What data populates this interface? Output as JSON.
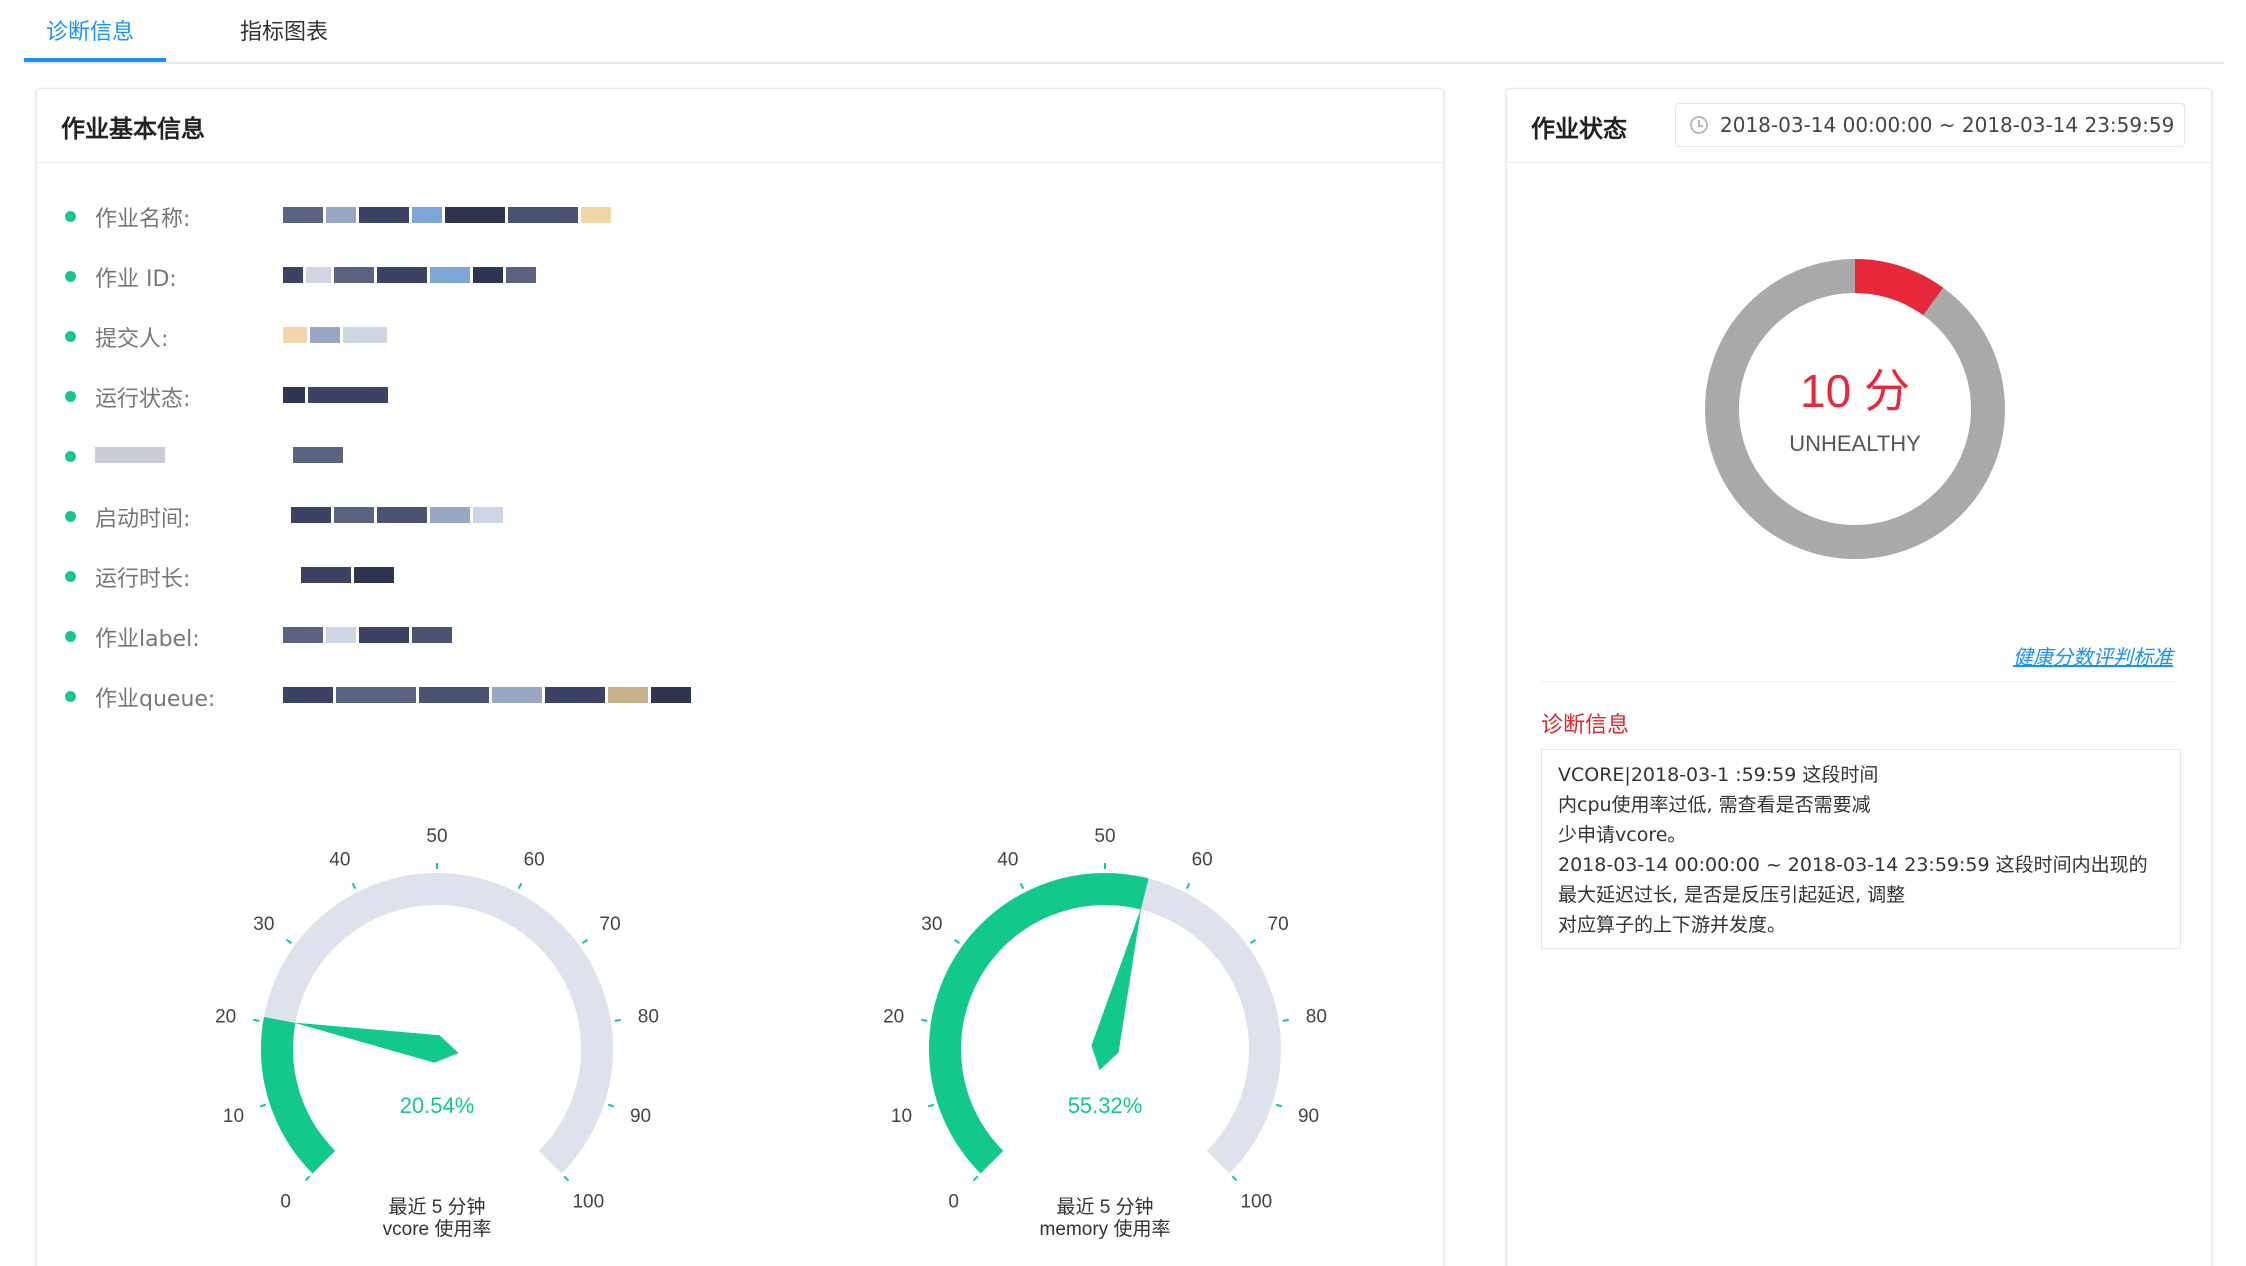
{
  "tabs": [
    {
      "label": "诊断信息",
      "active": true
    },
    {
      "label": "指标图表",
      "active": false
    }
  ],
  "basic_info": {
    "title": "作业基本信息",
    "items": [
      {
        "label": "作业名称:"
      },
      {
        "label": "作业 ID:"
      },
      {
        "label": "提交人:"
      },
      {
        "label": ""
      },
      {
        "label": "运行状态:"
      },
      {
        "label": "启动时间:"
      },
      {
        "label": "运行时长:"
      },
      {
        "label": "作业label:"
      },
      {
        "label": "作业queue:"
      }
    ]
  },
  "gauges": [
    {
      "name": "vcore",
      "value": 20.54,
      "value_text": "20.54%",
      "caption_line1": "最近 5 分钟",
      "caption_line2": "vcore 使用率"
    },
    {
      "name": "memory",
      "value": 55.32,
      "value_text": "55.32%",
      "caption_line1": "最近 5 分钟",
      "caption_line2": "memory 使用率"
    }
  ],
  "gauge_ticks": [
    "0",
    "10",
    "20",
    "30",
    "40",
    "50",
    "60",
    "70",
    "80",
    "90",
    "100"
  ],
  "status": {
    "title": "作业状态",
    "time_range": "2018-03-14 00:00:00  ~  2018-03-14 23:59:59",
    "score": 10,
    "score_text": "10 分",
    "health_label": "UNHEALTHY",
    "health_link": "健康分数评判标准",
    "diag_title": "诊断信息",
    "diag_lines": [
      "VCORE|2018-03-1                                        :59:59 这段时间",
      "内cpu使用率过低,                                        需查看是否需要减",
      "少申请vcore。",
      "2018-03-14 00:00:00 ~ 2018-03-14 23:59:59 这段时间内出现的",
      "最大延迟过长,                               是否是反压引起延迟, 调整",
      "对应算子的上下游并发度。"
    ]
  },
  "colors": {
    "accent": "#1890ff",
    "green": "#13c98a",
    "gauge_track": "#dde2ec",
    "red": "#e8283a",
    "donut_track": "#a9a9a9"
  }
}
